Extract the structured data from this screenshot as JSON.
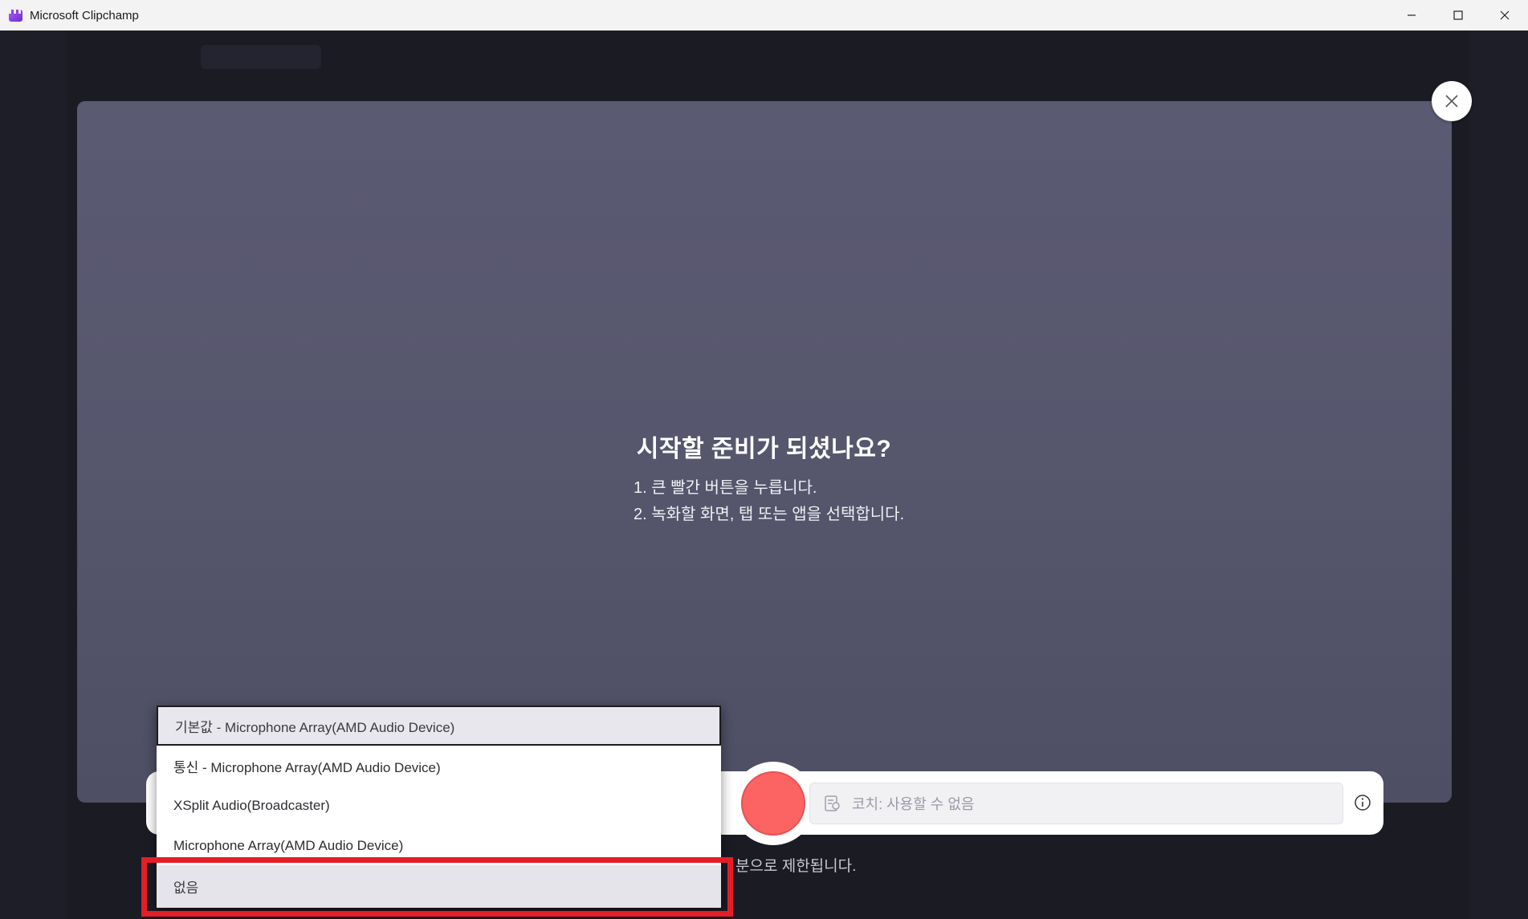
{
  "window": {
    "title": "Microsoft Clipchamp",
    "minimize_icon": "minimize-icon",
    "maximize_icon": "maximize-icon",
    "close_icon": "close-icon"
  },
  "recorder": {
    "heading": "시작할 준비가 되셨나요?",
    "steps": [
      "1. 큰 빨간 버튼을 누릅니다.",
      "2. 녹화할 화면, 탭 또는 앱을 선택합니다."
    ],
    "coach_placeholder": "코치: 사용할 수 없음",
    "note_partial": "분으로 제한됩니다.",
    "record_color": "#fc6464"
  },
  "microphone_dropdown": {
    "options": [
      "기본값 - Microphone Array(AMD Audio Device)",
      "통신 - Microphone Array(AMD Audio Device)",
      "XSplit Audio(Broadcaster)",
      "Microphone Array(AMD Audio Device)",
      "없음"
    ],
    "selected_index": 0,
    "highlighted_index": 4
  },
  "colors": {
    "highlight_border": "#e41e26",
    "stage_bg": "#56566d",
    "app_bg": "#1b1b24"
  }
}
